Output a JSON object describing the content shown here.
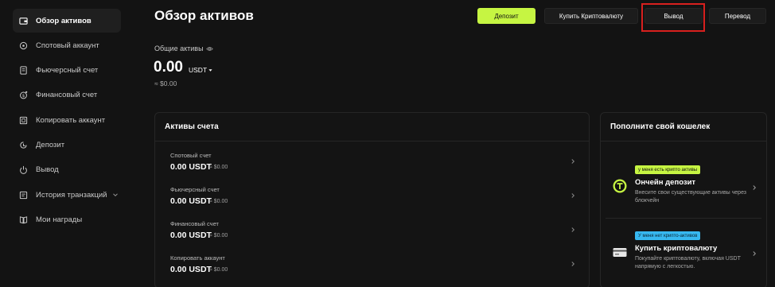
{
  "sidebar": {
    "items": [
      {
        "label": "Обзор активов",
        "icon": "wallet-icon"
      },
      {
        "label": "Спотовый аккаунт",
        "icon": "spot-icon"
      },
      {
        "label": "Фьючерсный счет",
        "icon": "futures-icon"
      },
      {
        "label": "Финансовый счет",
        "icon": "finance-icon"
      },
      {
        "label": "Копировать аккаунт",
        "icon": "copy-icon"
      },
      {
        "label": "Депозит",
        "icon": "deposit-icon"
      },
      {
        "label": "Вывод",
        "icon": "withdraw-icon"
      },
      {
        "label": "История транзакций",
        "icon": "history-icon"
      },
      {
        "label": "Мои награды",
        "icon": "rewards-icon"
      }
    ]
  },
  "header": {
    "title": "Обзор активов",
    "deposit_label": "Депозит",
    "buy_label": "Купить Криптовалюту",
    "withdraw_label": "Вывод",
    "transfer_label": "Перевод"
  },
  "balance": {
    "label": "Общие активы",
    "value": "0.00",
    "currency": "USDT",
    "approx": "≈ $0.00"
  },
  "accounts": {
    "title": "Активы счета",
    "rows": [
      {
        "name": "Спотовый счет",
        "value": "0.00 USDT",
        "approx": "≈ $0.00"
      },
      {
        "name": "Фьючерсный счет",
        "value": "0.00 USDT",
        "approx": "≈ $0.00"
      },
      {
        "name": "Финансовый счет",
        "value": "0.00 USDT",
        "approx": "≈ $0.00"
      },
      {
        "name": "Копировать аккаунт",
        "value": "0.00 USDT",
        "approx": "≈ $0.00"
      }
    ]
  },
  "wallet": {
    "title": "Пополните свой кошелек",
    "onchain": {
      "badge": "у меня есть крипто активы",
      "title": "Ончейн депозит",
      "desc": "Внесите свои существующие активы через блокчейн"
    },
    "buy": {
      "badge": "У меня нет крипто-активов",
      "title": "Купить криптовалюту",
      "desc": "Покупайте криптовалюту, включая USDT напрямую с легкостью."
    }
  },
  "colors": {
    "accent": "#c6f542",
    "badge_blue": "#37b8f0",
    "highlight": "#d8201e",
    "background": "#131313"
  }
}
